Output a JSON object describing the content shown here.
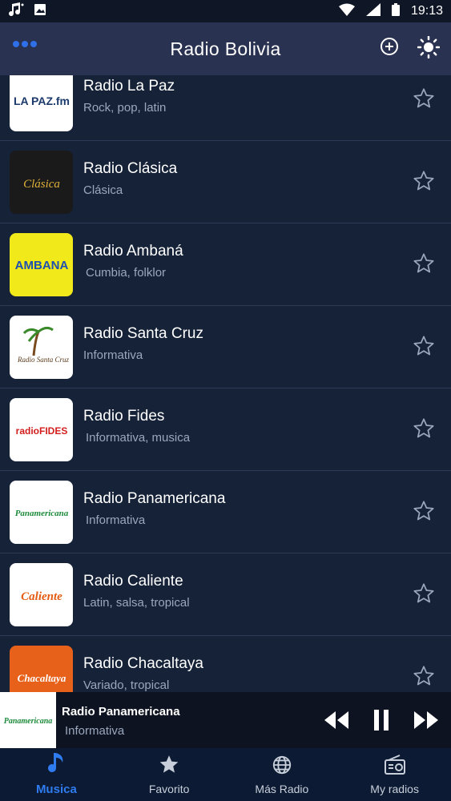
{
  "status": {
    "time": "19:13"
  },
  "app_bar": {
    "title": "Radio Bolivia"
  },
  "stations": [
    {
      "name": "Radio La Paz",
      "genre": "Rock, pop, latin",
      "logo_text": "LA PAZ.fm",
      "logo_bg": "#ffffff",
      "logo_fg": "#1b3a6b"
    },
    {
      "name": "Radio Clásica",
      "genre": "Clásica",
      "logo_text": "Clásica",
      "logo_bg": "#1a1a1a",
      "logo_fg": "#e0b23a"
    },
    {
      "name": "Radio Ambaná",
      "genre": "Cumbia, folklor",
      "logo_text": "AMBANA",
      "logo_bg": "#f2e91b",
      "logo_fg": "#1d4fb0"
    },
    {
      "name": "Radio Santa Cruz",
      "genre": "Informativa",
      "logo_text": "Radio Santa Cruz",
      "logo_bg": "#ffffff",
      "logo_fg": "#5b3a1a"
    },
    {
      "name": "Radio Fides",
      "genre": "Informativa, musica",
      "logo_text": "radioFIDES",
      "logo_bg": "#ffffff",
      "logo_fg": "#d21e1e"
    },
    {
      "name": "Radio Panamericana",
      "genre": "Informativa",
      "logo_text": "Panamericana",
      "logo_bg": "#ffffff",
      "logo_fg": "#1c8a3a"
    },
    {
      "name": "Radio Caliente",
      "genre": "Latin, salsa, tropical",
      "logo_text": "Caliente",
      "logo_bg": "#ffffff",
      "logo_fg": "#e35b12"
    },
    {
      "name": "Radio Chacaltaya",
      "genre": "Variado, tropical",
      "logo_text": "Chacaltaya",
      "logo_bg": "#e8611a",
      "logo_fg": "#ffffff"
    }
  ],
  "player": {
    "title": "Radio Panamericana",
    "subtitle": "Informativa",
    "logo_text": "Panamericana"
  },
  "nav": [
    {
      "label": "Musica",
      "icon": "music-note-icon",
      "active": true
    },
    {
      "label": "Favorito",
      "icon": "star-icon",
      "active": false
    },
    {
      "label": "Más Radio",
      "icon": "globe-icon",
      "active": false
    },
    {
      "label": "My radios",
      "icon": "radio-icon",
      "active": false
    }
  ],
  "colors": {
    "accent": "#2f7bf0",
    "background": "#162238",
    "app_bar": "#2a3252"
  }
}
